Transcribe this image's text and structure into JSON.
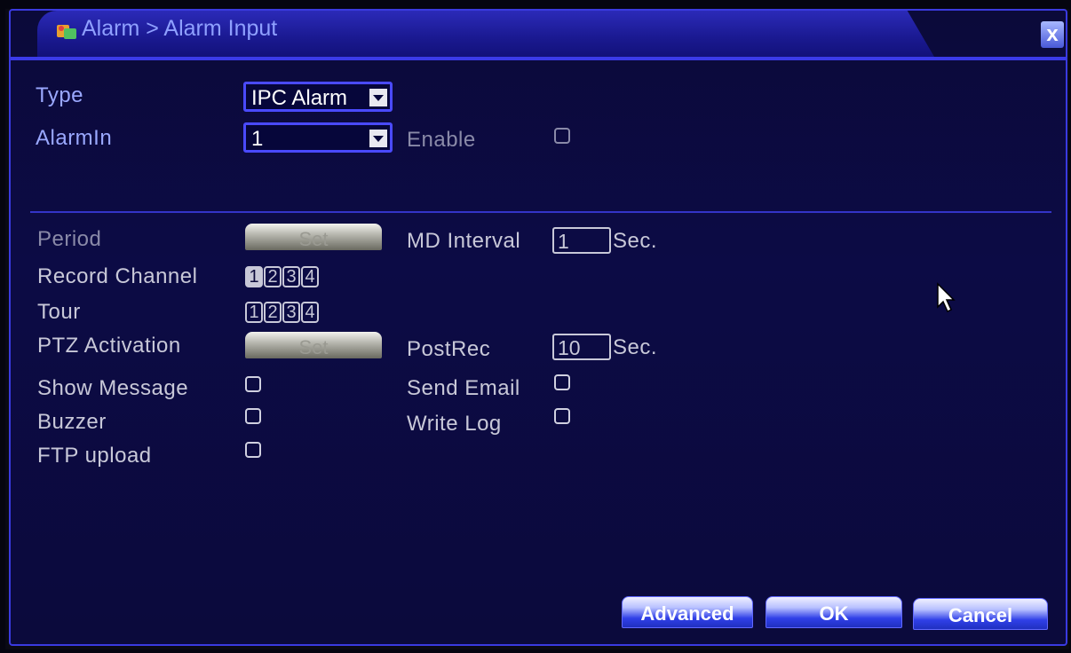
{
  "window": {
    "breadcrumb": "Alarm > Alarm Input",
    "close_label": "x"
  },
  "form": {
    "type_label": "Type",
    "type_value": "IPC Alarm",
    "alarmin_label": "AlarmIn",
    "alarmin_value": "1",
    "enable_label": "Enable",
    "enable_checked": false,
    "period_label": "Period",
    "period_button": "Set",
    "md_interval_label": "MD Interval",
    "md_interval_value": "1",
    "md_interval_unit": "Sec.",
    "record_channel_label": "Record Channel",
    "record_channels": [
      "1",
      "2",
      "3",
      "4"
    ],
    "record_channel_selected": "1",
    "tour_label": "Tour",
    "tour_channels": [
      "1",
      "2",
      "3",
      "4"
    ],
    "ptz_label": "PTZ Activation",
    "ptz_button": "Set",
    "postrec_label": "PostRec",
    "postrec_value": "10",
    "postrec_unit": "Sec.",
    "show_message_label": "Show Message",
    "send_email_label": "Send Email",
    "buzzer_label": "Buzzer",
    "write_log_label": "Write Log",
    "ftp_label": "FTP upload"
  },
  "buttons": {
    "advanced": "Advanced",
    "ok": "OK",
    "cancel": "Cancel"
  },
  "colors": {
    "background": "#0b0a3a",
    "accent": "#3a3ae0",
    "title_text": "#8fa0ff"
  }
}
